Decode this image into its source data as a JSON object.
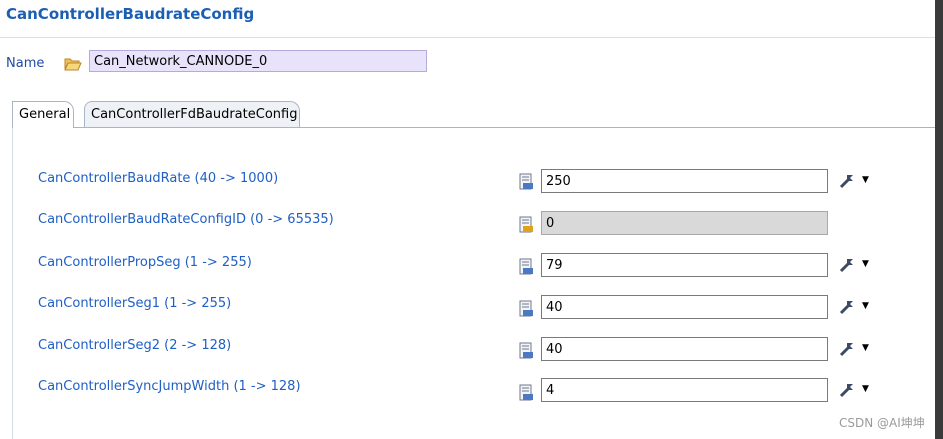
{
  "window": {
    "title": "CanControllerBaudrateConfig"
  },
  "name_row": {
    "label": "Name",
    "value": "Can_Network_CANNODE_0"
  },
  "tabs": [
    {
      "label": "General",
      "active": true
    },
    {
      "label": "CanControllerFdBaudrateConfig",
      "active": false
    }
  ],
  "params": [
    {
      "label": "CanControllerBaudRate (40 -> 1000)",
      "value": "250",
      "readonly": false
    },
    {
      "label": "CanControllerBaudRateConfigID (0 -> 65535)",
      "value": "0",
      "readonly": true
    },
    {
      "label": "CanControllerPropSeg (1 -> 255)",
      "value": "79",
      "readonly": false
    },
    {
      "label": "CanControllerSeg1 (1 -> 255)",
      "value": "40",
      "readonly": false
    },
    {
      "label": "CanControllerSeg2 (2 -> 128)",
      "value": "40",
      "readonly": false
    },
    {
      "label": "CanControllerSyncJumpWidth (1 -> 128)",
      "value": "4",
      "readonly": false
    }
  ],
  "icons": {
    "name_icon": "open-folder-icon",
    "field_icon": "numeric-value-icon",
    "field_icon_readonly": "numeric-value-locked-icon",
    "action_icon": "wand-icon",
    "dropdown_icon": "chevron-down-icon"
  },
  "colors": {
    "title": "#1a5fb4",
    "label": "#1f5fc4",
    "name_field_bg": "#e8e3fa",
    "readonly_field_bg": "#d9d9d9"
  },
  "watermark": "CSDN @AI坤坤"
}
